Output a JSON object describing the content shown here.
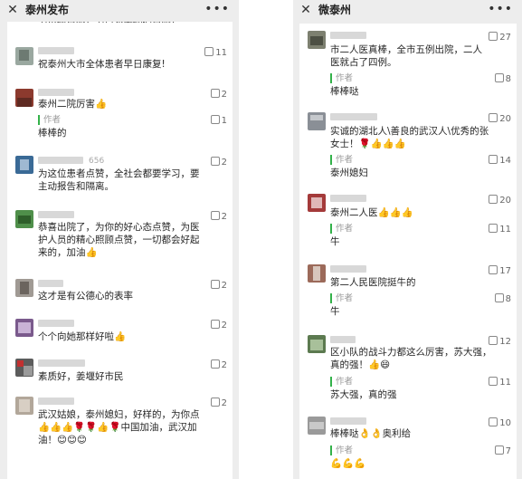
{
  "left": {
    "title": "泰州发布",
    "close_icon": "close-icon",
    "more_icon": "more-icon",
    "top_partial_text": "为小伙点赞！为白衣天使们点赞！",
    "top_partial_likes": "",
    "comments": [
      {
        "nick_suffix": "",
        "text": "祝泰州大市全体患者早日康复!",
        "likes": "11",
        "reply": null
      },
      {
        "nick_suffix": "",
        "text": "泰州二院厉害👍",
        "likes": "2",
        "reply": {
          "label": "作者",
          "text": "棒棒的",
          "likes": "1"
        }
      },
      {
        "nick_suffix": "656",
        "text": "为这位患者点赞，全社会都要学习，要主动报告和隔离。",
        "likes": "2",
        "reply": null
      },
      {
        "nick_suffix": "",
        "text": "恭喜出院了，为你的好心态点赞，为医护人员的精心照顾点赞，一切都会好起来的，加油👍",
        "likes": "2",
        "reply": null
      },
      {
        "nick_suffix": "",
        "text": "这才是有公德心的表率",
        "likes": "2",
        "reply": null
      },
      {
        "nick_suffix": "",
        "text": "个个向她那样好啦👍",
        "likes": "2",
        "reply": null
      },
      {
        "nick_suffix": "",
        "text": "素质好，姜堰好市民",
        "likes": "2",
        "reply": null
      },
      {
        "nick_suffix": "",
        "text": "武汉姑娘，泰州媳妇，好样的，为你点👍👍👍🌹🌹👍🌹中国加油，武汉加油！😊😊😊",
        "likes": "2",
        "reply": null
      }
    ]
  },
  "right": {
    "title": "微泰州",
    "close_icon": "close-icon",
    "more_icon": "more-icon",
    "comments": [
      {
        "text": "市二人医真棒，全市五例出院，二人医就占了四例。",
        "likes": "27",
        "reply": {
          "label": "作者",
          "text": "棒棒哒",
          "likes": "8"
        }
      },
      {
        "text": "实诚的湖北人\\善良的武汉人\\优秀的张女士！🌹👍👍👍",
        "likes": "20",
        "reply": {
          "label": "作者",
          "text": "泰州媳妇",
          "likes": "14"
        }
      },
      {
        "text": "泰州二人医👍👍👍",
        "likes": "20",
        "reply": {
          "label": "作者",
          "text": "牛",
          "likes": "11"
        }
      },
      {
        "text": "第二人民医院挺牛的",
        "likes": "17",
        "reply": {
          "label": "作者",
          "text": "牛",
          "likes": "8"
        }
      },
      {
        "text": "区小队的战斗力都这么厉害，苏大强，真的强！👍😄",
        "likes": "12",
        "reply": {
          "label": "作者",
          "text": "苏大强，真的强",
          "likes": "11"
        }
      },
      {
        "text": "棒棒哒👌👌奥利给",
        "likes": "10",
        "reply": {
          "label": "作者",
          "text": "💪💪💪",
          "likes": "7"
        }
      }
    ]
  },
  "colors": {
    "reply_accent": "#34b24a",
    "page_bg": "#ededed",
    "card_bg": "#ffffff"
  }
}
